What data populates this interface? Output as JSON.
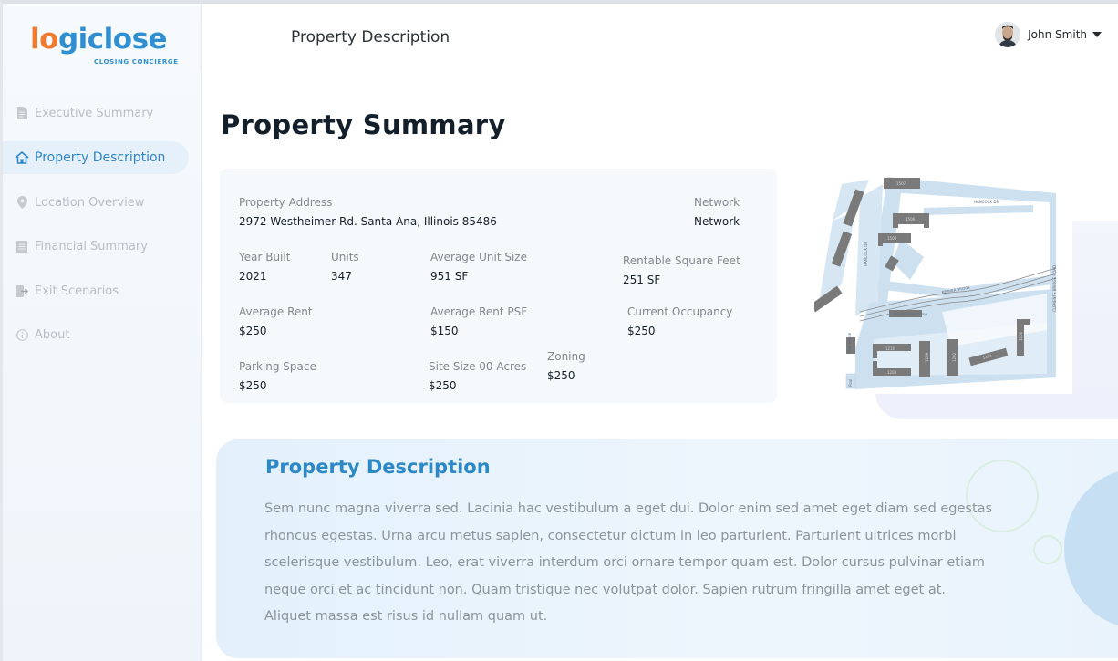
{
  "app": {
    "logo_text_1": "l",
    "logo_text_2": "o",
    "logo_text_3": "giclose",
    "logo_tagline": "CLOSING CONCIERGE"
  },
  "sidebar": {
    "items": [
      {
        "label": "Executive Summary",
        "icon": "document-icon",
        "active": false
      },
      {
        "label": "Property Description",
        "icon": "home-icon",
        "active": true
      },
      {
        "label": "Location Overview",
        "icon": "location-pin-icon",
        "active": false
      },
      {
        "label": "Financial Summary",
        "icon": "report-icon",
        "active": false
      },
      {
        "label": "Exit Scenarios",
        "icon": "exit-icon",
        "active": false
      },
      {
        "label": "About",
        "icon": "info-icon",
        "active": false
      }
    ]
  },
  "header": {
    "title": "Property Description",
    "user_name": "John Smith"
  },
  "main": {
    "page_title": "Property Summary",
    "summary": {
      "address_label": "Property Address",
      "address_value": "2972 Westheimer Rd. Santa Ana, Illinois 85486",
      "network_label": "Network",
      "network_value": "Network",
      "year_built_label": "Year Built",
      "year_built_value": "2021",
      "units_label": "Units",
      "units_value": "347",
      "avg_unit_size_label": "Average Unit Size",
      "avg_unit_size_value": "951 SF",
      "rentable_sqft_label": "Rentable Square Feet",
      "rentable_sqft_value": "251 SF",
      "avg_rent_label": "Average Rent",
      "avg_rent_value": "$250",
      "avg_rent_psf_label": "Average Rent PSF",
      "avg_rent_psf_value": "$150",
      "occupancy_label": "Current Occupancy",
      "occupancy_value": "$250",
      "parking_label": "Parking Space",
      "parking_value": "$250",
      "site_size_label": "Site  Size 00 Acres",
      "site_size_value": "$250",
      "zoning_label": "Zoning",
      "zoning_value": "$250"
    },
    "map": {
      "labels": [
        "1507",
        "1506",
        "1504",
        "1513",
        "1512",
        "1501",
        "1210",
        "1208",
        "1209",
        "1200",
        "1202",
        "1203",
        "HANCOCK DR",
        "CLEMENTS BRIDGE ROAD",
        "HANCOCK DR",
        "BEAVER BROOK",
        "Pool House",
        "Pool",
        "Maintenance Shop"
      ]
    },
    "description": {
      "title": "Property Description",
      "text": "Sem nunc magna viverra sed. Lacinia hac vestibulum a eget dui. Dolor enim sed amet eget diam sed egestas rhoncus egestas. Urna arcu metus sapien, consectetur dictum in leo parturient. Parturient ultrices morbi scelerisque vestibulum. Leo, erat viverra interdum orci ornare tempor quam est. Dolor cursus pulvinar etiam neque orci et ac tincidunt non. Quam tristique nec volutpat dolor. Sapien rutrum fringilla amet eget at. Aliquet massa est risus id nullam quam ut."
    }
  },
  "colors": {
    "accent_blue": "#2f86c8",
    "logo_orange": "#f07b2f",
    "map_blue": "#cde0f0",
    "building_gray": "#7a7a7a"
  }
}
